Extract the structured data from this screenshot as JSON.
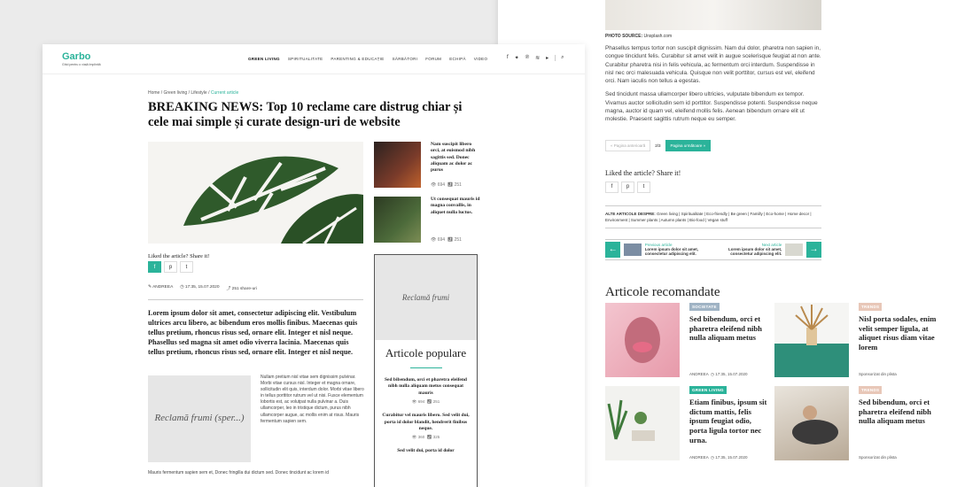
{
  "back": {
    "photo_source_label": "PHOTO SOURCE:",
    "photo_source_value": "Unsplash.com",
    "para1": "Phasellus tempus tortor non suscipit dignissim. Nam dui dolor, pharetra non sapien in, congue tincidunt felis. Curabitur sit amet velit in augue scelerisque feugiat at non ante. Curabitur pharetra nisi in felis vehicula, ac fermentum orci interdum. Suspendisse in nisl nec orci malesuada vehicula. Quisque non velit porttitor, cursus est vel, eleifend orci. Nam iaculis non tellus a egestas.",
    "para2": "Sed tincidunt massa ullamcorper libero ultricies, vulputate bibendum ex tempor. Vivamus auctor sollicitudin sem id porttitor. Suspendisse potenti. Suspendisse neque magna, auctor id quam vel, eleifend mollis felis. Aenean bibendum ornare elit ut molestie. Praesent sagittis rutrum neque eu semper.",
    "prev_label": "« Pagina anterioară",
    "page_counter": "2/3",
    "next_label": "Pagina următoare »",
    "share_title": "Liked the article? Share it!",
    "tags_label": "ALTE ARTICOLE DESPRE:",
    "tags_text": "Green living | Spiritualitate | Eco-friendly | Be green | Familly | Eco-home | Home decor | Environment | Summer plants | Autumn plants | Bio-food | Vegan stuff",
    "prev_article_label": "Previous article",
    "prev_article_title": "Lorem ipsum dolor sit amet, consectetur adipiscing elit.",
    "next_article_label": "Next article",
    "next_article_title": "Lorem ipsum dolor sit amet, consectetur adipiscing elit.",
    "reco_title": "Articole recomandate",
    "cards": [
      {
        "badge": "SOCIETATE",
        "badge_color": "#9fb3c4",
        "title": "Sed bibendum, orci et pharetra eleifend nibh nulla aliquam metus",
        "author": "ANDREEA",
        "date": "17:35, 15.07.2020"
      },
      {
        "badge": "TRENDS",
        "badge_color": "#e8c7b8",
        "title": "Nisl porta sodales, enim velit semper ligula, at aliquet risus diam vitae lorem",
        "sponsor": "Sponsorizat din plista"
      },
      {
        "badge": "GREEN LIVING",
        "badge_color": "#2bb39a",
        "title": "Etiam finibus, ipsum sit dictum mattis, felis ipsum feugiat odio, porta ligula tortor nec urna.",
        "author": "ANDREEA",
        "date": "17:35, 15.07.2020"
      },
      {
        "badge": "TRENDS",
        "badge_color": "#e8c7b8",
        "title": "Sed bibendum, orci et pharetra eleifend nibh nulla aliquam metus",
        "sponsor": "Sponsorizat din plista"
      }
    ]
  },
  "front": {
    "logo": "Garbo",
    "tagline": "Ghid pentru o viață împlinită",
    "menu": [
      "GREEN LIVING",
      "SPIRITUALITATE",
      "PARENTING & EDUCAȚIE",
      "SĂRBĂTORI",
      "FORUM",
      "ECHIPĂ",
      "VIDEO"
    ],
    "social": [
      "f",
      "t",
      "p",
      "r",
      "y"
    ],
    "breadcrumb": "Home / Green living / Lifestyle /",
    "breadcrumb_current": "Current article",
    "title": "BREAKING NEWS: Top 10 reclame care distrug chiar și cele mai simple și curate design-uri de website",
    "side_articles": [
      {
        "title": "Nam suscipit libero orci, at euismod nibh sagittis sed. Donec aliquam ac dolor ac purus",
        "views": "694",
        "shares": "251"
      },
      {
        "title": "Ut consequat mauris id magna convallis, in aliquet nulla luctus.",
        "views": "694",
        "shares": "251"
      }
    ],
    "share_title": "Liked the article? Share it!",
    "author": "ANDREEA",
    "date": "17:35, 15.07.2020",
    "share_count": "251 share-uri",
    "lead": "Lorem ipsum dolor sit amet, consectetur adipiscing elit. Vestibulum ultrices arcu libero, ac bibendum eros mollis finibus. Maecenas quis tellus pretium, rhoncus risus sed, ornare elit. Integer et nisl neque. Phasellus sed magna sit amet odio viverra lacinia.  Maecenas quis tellus pretium, rhoncus risus sed, ornare elit. Integer et nisl neque.",
    "ad_text": "Reclamă frumi (sper...)",
    "body_right": "Nullam pretium nisl vitae sem dignissim pulvinar. Morbi vitae cursus nisl. Integer et magna ornare, sollicitudin elit quis, interdum dolor. Morbi vitae libero in tellus porttitor rutrum vel ut nisi. Fusce elementum lobortis est, ac volutpat nulla pulvinar a. Duis ullamcorper, leo in tristique dictum, purus nibh ullamcorper augue, ac mollis  enim at risus. Mauris fermentum sapien sem.",
    "body_bottom": "Mauris fermentum sapien sem et, Donec fringilla dui dictum sed. Donec tincidunt ac lorem id",
    "sidebar_ad": "Reclamă frumi",
    "popular_title": "Articole populare",
    "popular": [
      {
        "title": "Sed bibendum, orci et pharetra eleifend  nibh nulla aliquam metus consequat mauris",
        "views": "694",
        "shares": "251"
      },
      {
        "title": "Curabitur vel mauris libero. Sed velit dui, porta id dolor blandit, hendrerit finibus neque.",
        "views": "360",
        "shares": "325"
      },
      {
        "title": "Sed velit dui, porta id dolor"
      }
    ]
  }
}
